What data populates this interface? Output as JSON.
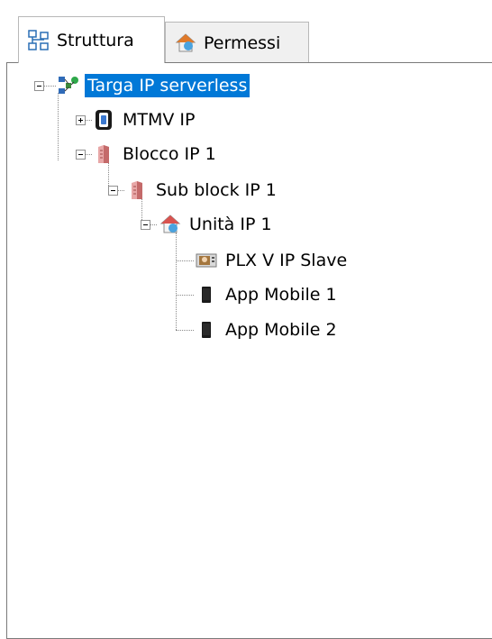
{
  "tabs": [
    {
      "label": "Struttura",
      "icon": "structure-icon"
    },
    {
      "label": "Permessi",
      "icon": "home-permissions-icon"
    }
  ],
  "tree": {
    "root": {
      "label": "Targa IP serverless",
      "icon": "network-nodes-icon"
    },
    "mtmv": {
      "label": "MTMV IP",
      "icon": "mtmv-device-icon"
    },
    "blocco": {
      "label": "Blocco IP 1",
      "icon": "building-icon"
    },
    "subblock": {
      "label": "Sub block IP 1",
      "icon": "building-icon"
    },
    "unita": {
      "label": "Unità IP 1",
      "icon": "house-icon"
    },
    "plx": {
      "label": "PLX V IP Slave",
      "icon": "monitor-icon"
    },
    "app1": {
      "label": "App Mobile 1",
      "icon": "phone-icon"
    },
    "app2": {
      "label": "App Mobile 2",
      "icon": "phone-icon"
    }
  },
  "colors": {
    "selection": "#0078d7"
  }
}
